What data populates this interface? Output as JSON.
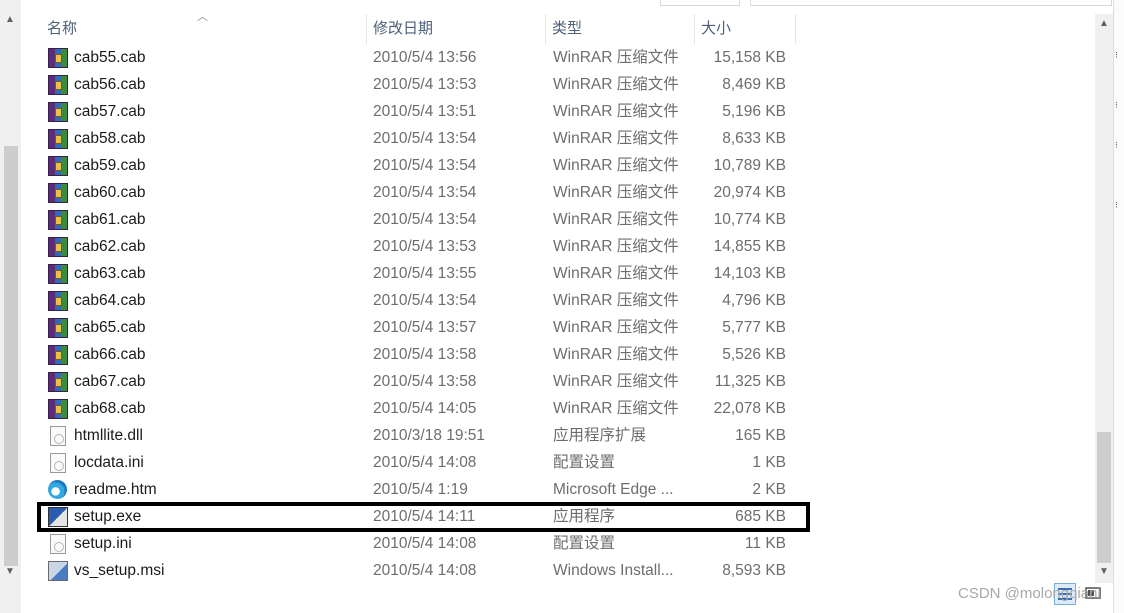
{
  "columns": {
    "name": "名称",
    "date": "修改日期",
    "type": "类型",
    "size": "大小"
  },
  "files": [
    {
      "name": "cab55.cab",
      "date": "2010/5/4 13:56",
      "type": "WinRAR 压缩文件",
      "size": "15,158 KB",
      "icon": "rar-archive-icon"
    },
    {
      "name": "cab56.cab",
      "date": "2010/5/4 13:53",
      "type": "WinRAR 压缩文件",
      "size": "8,469 KB",
      "icon": "rar-archive-icon"
    },
    {
      "name": "cab57.cab",
      "date": "2010/5/4 13:51",
      "type": "WinRAR 压缩文件",
      "size": "5,196 KB",
      "icon": "rar-archive-icon"
    },
    {
      "name": "cab58.cab",
      "date": "2010/5/4 13:54",
      "type": "WinRAR 压缩文件",
      "size": "8,633 KB",
      "icon": "rar-archive-icon"
    },
    {
      "name": "cab59.cab",
      "date": "2010/5/4 13:54",
      "type": "WinRAR 压缩文件",
      "size": "10,789 KB",
      "icon": "rar-archive-icon"
    },
    {
      "name": "cab60.cab",
      "date": "2010/5/4 13:54",
      "type": "WinRAR 压缩文件",
      "size": "20,974 KB",
      "icon": "rar-archive-icon"
    },
    {
      "name": "cab61.cab",
      "date": "2010/5/4 13:54",
      "type": "WinRAR 压缩文件",
      "size": "10,774 KB",
      "icon": "rar-archive-icon"
    },
    {
      "name": "cab62.cab",
      "date": "2010/5/4 13:53",
      "type": "WinRAR 压缩文件",
      "size": "14,855 KB",
      "icon": "rar-archive-icon"
    },
    {
      "name": "cab63.cab",
      "date": "2010/5/4 13:55",
      "type": "WinRAR 压缩文件",
      "size": "14,103 KB",
      "icon": "rar-archive-icon"
    },
    {
      "name": "cab64.cab",
      "date": "2010/5/4 13:54",
      "type": "WinRAR 压缩文件",
      "size": "4,796 KB",
      "icon": "rar-archive-icon"
    },
    {
      "name": "cab65.cab",
      "date": "2010/5/4 13:57",
      "type": "WinRAR 压缩文件",
      "size": "5,777 KB",
      "icon": "rar-archive-icon"
    },
    {
      "name": "cab66.cab",
      "date": "2010/5/4 13:58",
      "type": "WinRAR 压缩文件",
      "size": "5,526 KB",
      "icon": "rar-archive-icon"
    },
    {
      "name": "cab67.cab",
      "date": "2010/5/4 13:58",
      "type": "WinRAR 压缩文件",
      "size": "11,325 KB",
      "icon": "rar-archive-icon"
    },
    {
      "name": "cab68.cab",
      "date": "2010/5/4 14:05",
      "type": "WinRAR 压缩文件",
      "size": "22,078 KB",
      "icon": "rar-archive-icon"
    },
    {
      "name": "htmllite.dll",
      "date": "2010/3/18 19:51",
      "type": "应用程序扩展",
      "size": "165 KB",
      "icon": "dll-file-icon"
    },
    {
      "name": "locdata.ini",
      "date": "2010/5/4 14:08",
      "type": "配置设置",
      "size": "1 KB",
      "icon": "ini-file-icon"
    },
    {
      "name": "readme.htm",
      "date": "2010/5/4 1:19",
      "type": "Microsoft Edge ...",
      "size": "2 KB",
      "icon": "edge-icon"
    },
    {
      "name": "setup.exe",
      "date": "2010/5/4 14:11",
      "type": "应用程序",
      "size": "685 KB",
      "icon": "exe-file-icon"
    },
    {
      "name": "setup.ini",
      "date": "2010/5/4 14:08",
      "type": "配置设置",
      "size": "11 KB",
      "icon": "ini-file-icon"
    },
    {
      "name": "vs_setup.msi",
      "date": "2010/5/4 14:08",
      "type": "Windows Install...",
      "size": "8,593 KB",
      "icon": "msi-file-icon"
    }
  ],
  "watermark": "CSDN @molongqiani"
}
